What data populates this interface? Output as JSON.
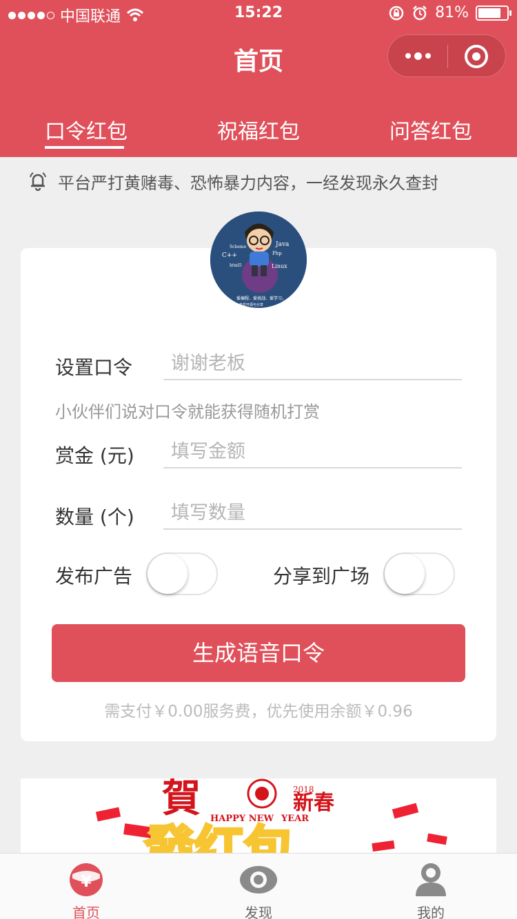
{
  "status_bar": {
    "carrier": "中国联通",
    "time": "15:22",
    "battery": "81%"
  },
  "nav": {
    "title": "首页"
  },
  "tabs": [
    {
      "label": "口令红包",
      "active": true
    },
    {
      "label": "祝福红包",
      "active": false
    },
    {
      "label": "问答红包",
      "active": false
    }
  ],
  "notice": {
    "text": "平台严打黄赌毒、恐怖暴力内容，一经发现永久查封"
  },
  "avatar": {
    "texts": [
      "Java",
      "Scheme",
      "C++",
      "Php",
      "html5",
      "Linux",
      "爱编程、爱挑战、爱学习，",
      "热爱开源与分享"
    ]
  },
  "form": {
    "password_label": "设置口令",
    "password_placeholder": "谢谢老板",
    "hint": "小伙伴们说对口令就能获得随机打赏",
    "amount_label": "赏金 (元)",
    "amount_placeholder": "填写金额",
    "count_label": "数量 (个)",
    "count_placeholder": "填写数量",
    "ad_label": "发布广告",
    "share_label": "分享到广场",
    "ad_on": false,
    "share_on": false,
    "submit_label": "生成语音口令",
    "fee_text": "需支付￥0.00服务费，优先使用余额￥0.96"
  },
  "banner": {
    "text_he": "賀",
    "text_xin": "新春",
    "text_year": "2018",
    "text_happy": "HAPPY NEW",
    "text_year_word": "YEAR",
    "text_big": "發红包"
  },
  "tabbar": [
    {
      "label": "首页",
      "icon": "home-icon",
      "active": true
    },
    {
      "label": "发现",
      "icon": "discover-icon",
      "active": false
    },
    {
      "label": "我的",
      "icon": "profile-icon",
      "active": false
    }
  ],
  "colors": {
    "primary": "#e0505a",
    "background": "#efefef"
  }
}
